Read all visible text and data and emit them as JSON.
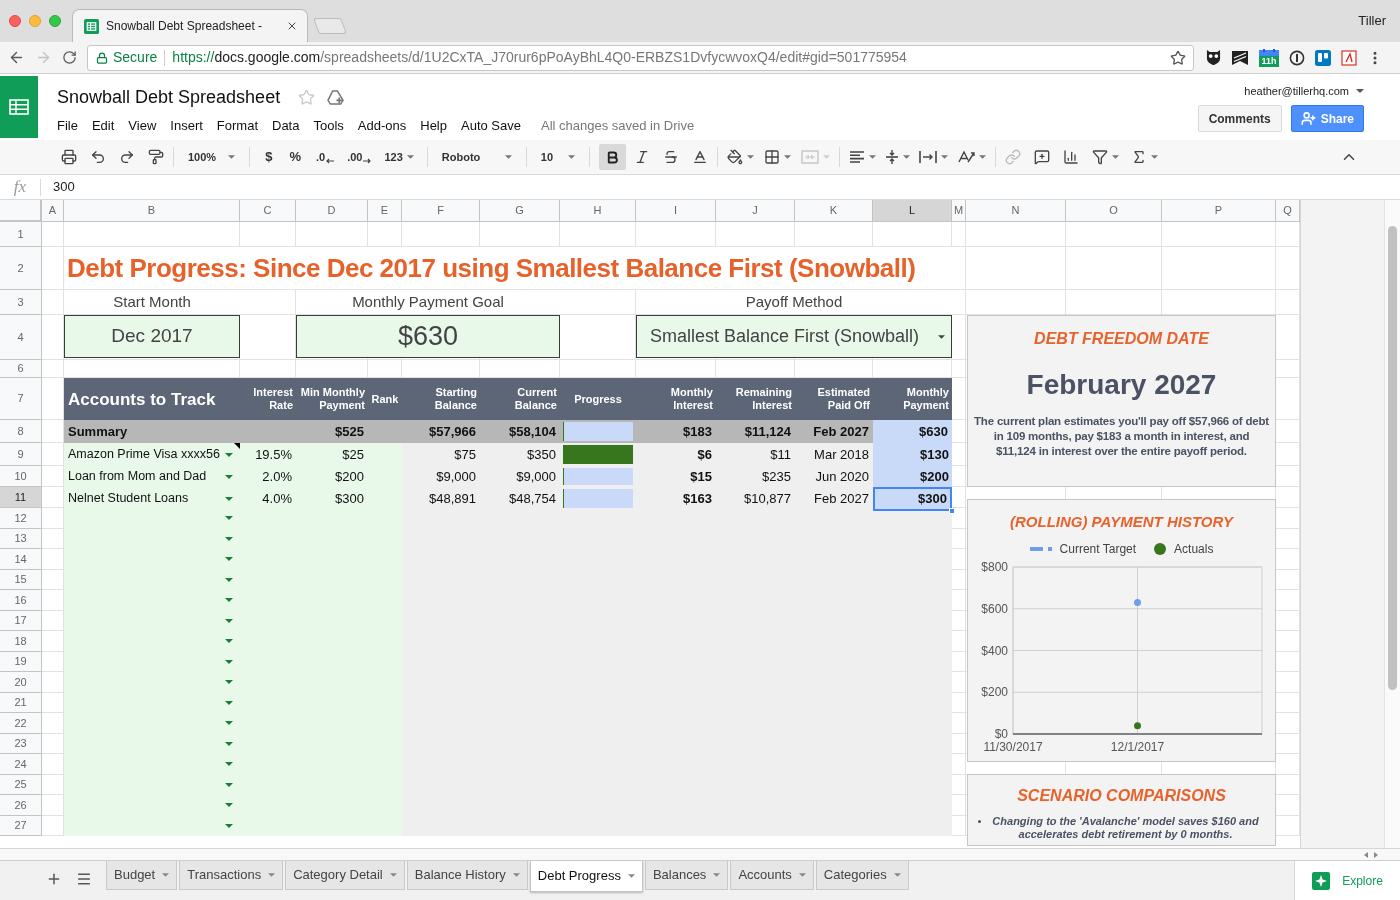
{
  "browser": {
    "tab_title": "Snowball Debt Spreadsheet -",
    "profile": "Tiller",
    "secure_label": "Secure",
    "url": {
      "scheme": "https://",
      "host": "docs.google.com",
      "path": "/spreadsheets/d/1U2CxTA_J70rur6pPoAyBhL4Q0-ERBZS1DvfycwvoxQ4/edit#gid=501775954"
    },
    "calendar_badge": "11h"
  },
  "document": {
    "title": "Snowball Debt Spreadsheet",
    "menus": [
      "File",
      "Edit",
      "View",
      "Insert",
      "Format",
      "Data",
      "Tools",
      "Add-ons",
      "Help",
      "Auto Save"
    ],
    "save_status": "All changes saved in Drive",
    "account": "heather@tillerhq.com",
    "comments_button": "Comments",
    "share_button": "Share"
  },
  "toolbar": {
    "zoom": "100%",
    "currency": "$",
    "percent": "%",
    "decimal_decrease": ".0",
    "decimal_increase": ".00",
    "more_formats": "123",
    "font": "Roboto",
    "font_size": "10",
    "bold_active": true
  },
  "formula_bar": {
    "label": "fx",
    "value": "300"
  },
  "sheet": {
    "column_letters": [
      {
        "label": "A",
        "selected": false
      },
      {
        "label": "B",
        "selected": false
      },
      {
        "label": "C",
        "selected": false
      },
      {
        "label": "D",
        "selected": false
      },
      {
        "label": "E",
        "selected": false
      },
      {
        "label": "F",
        "selected": false
      },
      {
        "label": "G",
        "selected": false
      },
      {
        "label": "H",
        "selected": false
      },
      {
        "label": "I",
        "selected": false
      },
      {
        "label": "J",
        "selected": false
      },
      {
        "label": "K",
        "selected": false
      },
      {
        "label": "L",
        "selected": true
      },
      {
        "label": "M",
        "selected": false
      },
      {
        "label": "N",
        "selected": false
      },
      {
        "label": "O",
        "selected": false
      },
      {
        "label": "P",
        "selected": false
      },
      {
        "label": "Q",
        "selected": false
      }
    ],
    "row_numbers": [
      {
        "label": "1",
        "selected": false
      },
      {
        "label": "2",
        "selected": false
      },
      {
        "label": "3",
        "selected": false
      },
      {
        "label": "4",
        "selected": false
      },
      {
        "label": "6",
        "selected": false
      },
      {
        "label": "7",
        "selected": false
      },
      {
        "label": "8",
        "selected": false
      },
      {
        "label": "9",
        "selected": false
      },
      {
        "label": "10",
        "selected": false
      },
      {
        "label": "11",
        "selected": true
      },
      {
        "label": "12",
        "selected": false
      },
      {
        "label": "13",
        "selected": false
      },
      {
        "label": "14",
        "selected": false
      },
      {
        "label": "15",
        "selected": false
      },
      {
        "label": "16",
        "selected": false
      },
      {
        "label": "17",
        "selected": false
      },
      {
        "label": "18",
        "selected": false
      },
      {
        "label": "19",
        "selected": false
      },
      {
        "label": "20",
        "selected": false
      },
      {
        "label": "21",
        "selected": false
      },
      {
        "label": "22",
        "selected": false
      },
      {
        "label": "23",
        "selected": false
      },
      {
        "label": "24",
        "selected": false
      },
      {
        "label": "25",
        "selected": false
      },
      {
        "label": "26",
        "selected": false
      },
      {
        "label": "27",
        "selected": false
      }
    ],
    "title": "Debt Progress: Since Dec 2017 using Smallest Balance First (Snowball)",
    "settings": [
      {
        "kind": "text_cell",
        "label": "Start Month",
        "value": "Dec 2017"
      },
      {
        "kind": "amount_cell",
        "label": "Monthly Payment Goal",
        "value": "$630"
      },
      {
        "kind": "dropdown",
        "label": "Payoff Method",
        "value": "Smallest Balance First (Snowball)"
      }
    ],
    "table": {
      "columns": [
        "Accounts to Track",
        "Interest Rate",
        "Min Monthly Payment",
        "Rank",
        "Starting Balance",
        "Current Balance",
        "Progress",
        "Monthly Interest",
        "Remaining Interest",
        "Estimated Paid Off",
        "Monthly Payment"
      ],
      "summary": {
        "label": "Summary",
        "min_payment": "$525",
        "starting_balance": "$57,966",
        "current_balance": "$58,104",
        "progress": {
          "level": 0
        },
        "monthly_interest": "$183",
        "remaining_interest": "$11,124",
        "paid_off": "Feb 2027",
        "monthly_payment": "$630"
      },
      "accounts": [
        {
          "name": "Amazon Prime Visa xxxx56",
          "note": true,
          "interest_rate": "19.5%",
          "min_payment": "$25",
          "starting_balance": "$75",
          "current_balance": "$350",
          "progress": {
            "level": 1
          },
          "monthly_interest": "$6",
          "remaining_interest": "$11",
          "paid_off": "Mar 2018",
          "monthly_payment": "$130",
          "selected": false
        },
        {
          "name": "Loan from Mom and Dad",
          "note": false,
          "interest_rate": "2.0%",
          "min_payment": "$200",
          "starting_balance": "$9,000",
          "current_balance": "$9,000",
          "progress": {
            "level": 0
          },
          "monthly_interest": "$15",
          "remaining_interest": "$235",
          "paid_off": "Jun 2020",
          "monthly_payment": "$200",
          "selected": false
        },
        {
          "name": "Nelnet Student Loans",
          "note": false,
          "interest_rate": "4.0%",
          "min_payment": "$300",
          "starting_balance": "$48,891",
          "current_balance": "$48,754",
          "progress": {
            "level": 0
          },
          "monthly_interest": "$163",
          "remaining_interest": "$10,877",
          "paid_off": "Feb 2027",
          "monthly_payment": "$300",
          "selected": true
        }
      ]
    }
  },
  "panels": {
    "freedom": {
      "title": "DEBT FREEDOM DATE",
      "date": "February 2027",
      "text": "The current plan estimates you'll pay off $57,966 of debt in 109 months, pay $183 a month in interest, and $11,124 in interest over the entire payoff period."
    },
    "payment_history": {
      "chart_data": {
        "type": "line",
        "title": "(ROLLING) PAYMENT HISTORY",
        "legend": "top",
        "categories": [
          "11/30/2017",
          "12/1/2017"
        ],
        "series": [
          {
            "name": "Current Target",
            "color": "#6d9eeb",
            "marker": "circle",
            "values": [
              null,
              630
            ]
          },
          {
            "name": "Actuals",
            "color": "#38761d",
            "marker": "circle",
            "values": [
              null,
              40
            ]
          }
        ],
        "ylim": [
          0,
          800
        ],
        "yticks": [
          {
            "value": 0,
            "label": "$0"
          },
          {
            "value": 200,
            "label": "$200"
          },
          {
            "value": 400,
            "label": "$400"
          },
          {
            "value": 600,
            "label": "$600"
          },
          {
            "value": 800,
            "label": "$800"
          }
        ],
        "grid": true
      }
    },
    "scenarios": {
      "title": "SCENARIO COMPARISONS",
      "items": [
        "Changing to the 'Avalanche' model saves $160 and accelerates debt retirement by 0 months."
      ]
    }
  },
  "sheet_tabs": [
    {
      "label": "Budget",
      "selected": false
    },
    {
      "label": "Transactions",
      "selected": false
    },
    {
      "label": "Category Detail",
      "selected": false
    },
    {
      "label": "Balance History",
      "selected": false
    },
    {
      "label": "Debt Progress",
      "selected": true
    },
    {
      "label": "Balances",
      "selected": false
    },
    {
      "label": "Accounts",
      "selected": false
    },
    {
      "label": "Categories",
      "selected": false
    }
  ],
  "explore_button": "Explore"
}
